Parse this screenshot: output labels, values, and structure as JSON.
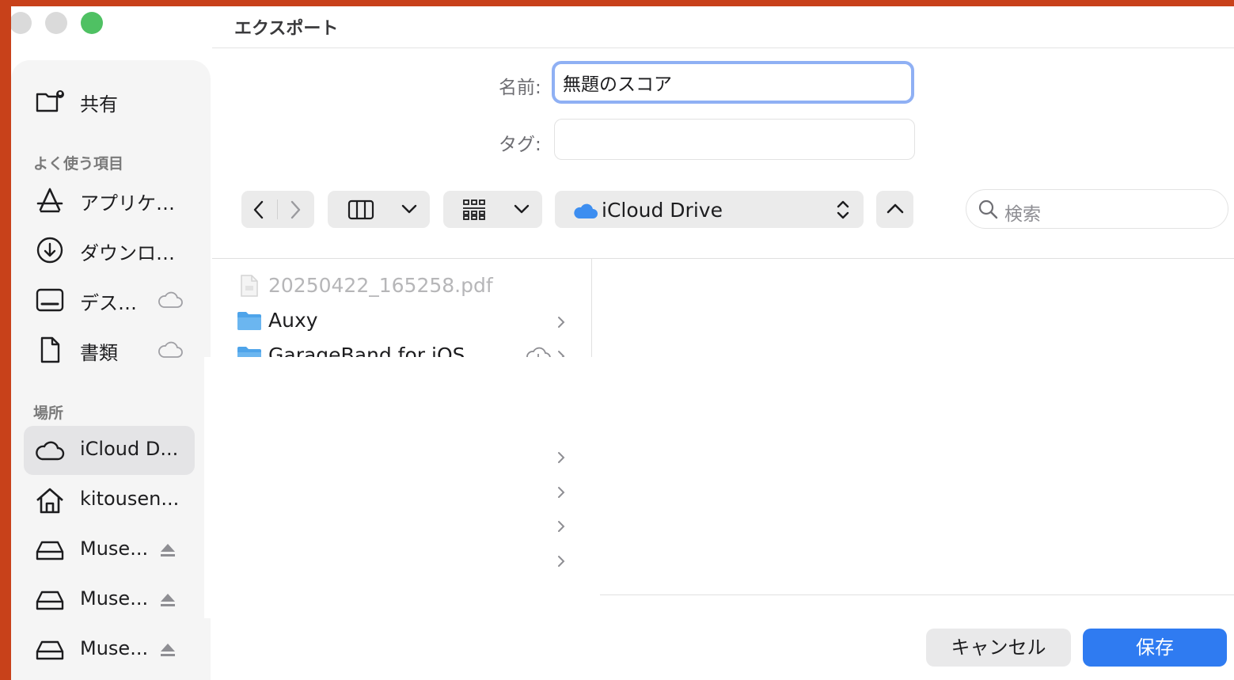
{
  "window": {
    "title": "エクスポート"
  },
  "sidebar": {
    "shared": {
      "label": "共有",
      "icon": "shared-folder-icon"
    },
    "favorites_header": "よく使う項目",
    "favorites": [
      {
        "label": "アプリケ…",
        "icon": "applications-icon"
      },
      {
        "label": "ダウンロ…",
        "icon": "downloads-icon"
      },
      {
        "label": "デス…",
        "icon": "desktop-icon",
        "cloud": true
      },
      {
        "label": "書類",
        "icon": "documents-icon",
        "cloud": true
      }
    ],
    "locations_header": "場所",
    "locations": [
      {
        "label": "iCloud D...",
        "icon": "icloud-icon",
        "selected": true
      },
      {
        "label": "kitousen...",
        "icon": "home-icon"
      },
      {
        "label": "Muse...",
        "icon": "drive-icon",
        "eject": true
      },
      {
        "label": "Muse...",
        "icon": "drive-icon",
        "eject": true
      },
      {
        "label": "Muse...",
        "icon": "drive-icon",
        "eject": true
      }
    ]
  },
  "form": {
    "name_label": "名前:",
    "name_value": "無題のスコア",
    "tag_label": "タグ:",
    "tag_value": ""
  },
  "toolbar": {
    "location": "iCloud Drive",
    "search_placeholder": "検索"
  },
  "files": [
    {
      "name": "20250422_165258.pdf",
      "type": "pdf",
      "dimmed": true
    },
    {
      "name": "Auxy",
      "type": "folder"
    },
    {
      "name": "GarageBand for iOS",
      "type": "folder",
      "cloud_download": true
    }
  ],
  "buttons": {
    "cancel": "キャンセル",
    "save": "保存"
  },
  "colors": {
    "desktop_bg": "#c8411a",
    "accent": "#2f7bf1",
    "focus_ring": "#8fb0f4",
    "traffic_close": "#d9d9d9",
    "traffic_min": "#d9d9d9",
    "traffic_zoom": "#4fc163"
  }
}
